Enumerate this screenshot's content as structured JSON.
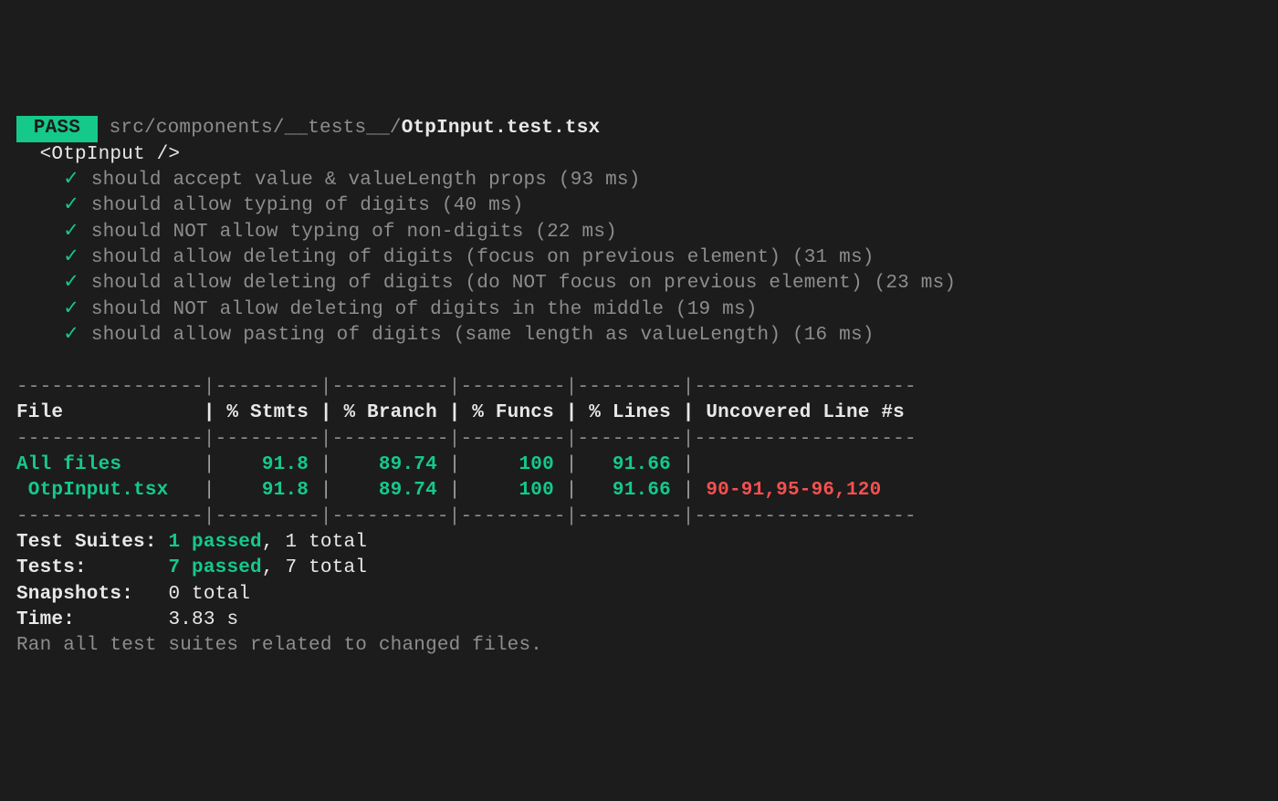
{
  "status_badge": " PASS ",
  "path_prefix": "src/components/__tests__/",
  "file_name": "OtpInput.test.tsx",
  "suite_name": "<OtpInput />",
  "tests": [
    {
      "label": "should accept value & valueLength props",
      "ms": "93 ms"
    },
    {
      "label": "should allow typing of digits",
      "ms": "40 ms"
    },
    {
      "label": "should NOT allow typing of non-digits",
      "ms": "22 ms"
    },
    {
      "label": "should allow deleting of digits (focus on previous element)",
      "ms": "31 ms"
    },
    {
      "label": "should allow deleting of digits (do NOT focus on previous element)",
      "ms": "23 ms"
    },
    {
      "label": "should NOT allow deleting of digits in the middle",
      "ms": "19 ms"
    },
    {
      "label": "should allow pasting of digits (same length as valueLength)",
      "ms": "16 ms"
    }
  ],
  "coverage": {
    "divider": "----------------|---------|----------|---------|---------|-------------------",
    "header": "File            | % Stmts | % Branch | % Funcs | % Lines | Uncovered Line #s ",
    "rows": [
      {
        "file": "All files      ",
        "stmts": "91.8",
        "branch": "89.74",
        "funcs": "100",
        "lines": "91.66",
        "uncovered": ""
      },
      {
        "file": " OtpInput.tsx  ",
        "stmts": "91.8",
        "branch": "89.74",
        "funcs": "100",
        "lines": "91.66",
        "uncovered": "90-91,95-96,120"
      }
    ]
  },
  "summary": {
    "suites_label": "Test Suites:",
    "suites_passed": "1 passed",
    "suites_total": "1 total",
    "tests_label": "Tests:",
    "tests_passed": "7 passed",
    "tests_total": "7 total",
    "snapshots_label": "Snapshots:",
    "snapshots_value": "0 total",
    "time_label": "Time:",
    "time_value": "3.83 s"
  },
  "footer": "Ran all test suites related to changed files."
}
